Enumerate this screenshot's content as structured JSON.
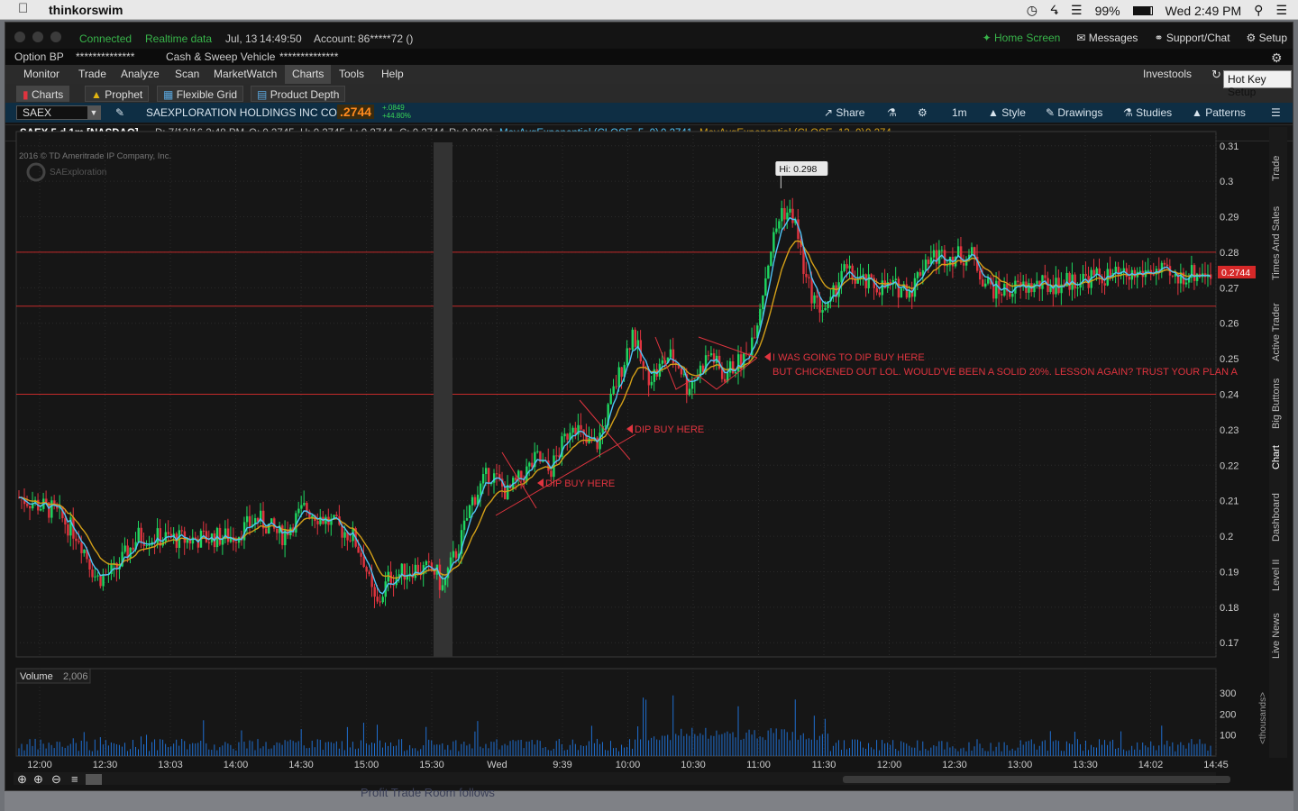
{
  "menubar": {
    "app_name": "thinkorswim",
    "battery": "99%",
    "clock": "Wed 2:49 PM"
  },
  "status": {
    "connected": "Connected",
    "realtime": "Realtime data",
    "date": "Jul, 13",
    "time": "14:49:50",
    "account_label": "Account:",
    "account_value": "86*****72 ()"
  },
  "top_right": {
    "home": "Home Screen",
    "messages": "Messages",
    "support": "Support/Chat",
    "setup": "Setup"
  },
  "bp_row": {
    "option_bp": "Option BP",
    "bp_value": "**************",
    "cash": "Cash & Sweep Vehicle",
    "cash_value": "**************"
  },
  "menu": {
    "items": [
      "Monitor",
      "Trade",
      "Analyze",
      "Scan",
      "MarketWatch",
      "Charts",
      "Tools",
      "Help"
    ],
    "investools": "Investools"
  },
  "subtabs": {
    "charts": "Charts",
    "prophet": "Prophet",
    "flexible": "Flexible Grid",
    "product_depth": "Product Depth"
  },
  "hotkey": "Hot Key Setup",
  "symbol_bar": {
    "symbol": "SAEX",
    "company": "SAEXPLORATION HOLDINGS INC COM",
    "price": ".2744",
    "change": "+.0849",
    "change_pct": "+44.80%",
    "share": "Share",
    "timeframe": "1m",
    "style": "Style",
    "drawings": "Drawings",
    "studies": "Studies",
    "patterns": "Patterns"
  },
  "info_row": {
    "title": "SAEX 5 d 1m [NASDAQ]",
    "d": "D: 7/13/16 2:48 PM",
    "o": "O: 0.2745",
    "h": "H: 0.2745",
    "l": "L: 0.2744",
    "c": "C: 0.2744",
    "r": "R: 0.0001",
    "ma5": "MovAvgExponential (CLOSE, 5, 0)",
    "ma5_val": "0.2741",
    "ma13": "MovAvgExponential (CLOSE, 13, 0)",
    "ma13_val": "0.274"
  },
  "watermark": {
    "copyright": "2016 © TD Ameritrade IP Company, Inc.",
    "logo_text": "SAExploration"
  },
  "annotations": {
    "hi": "Hi: 0.298",
    "dip1": "DIP BUY HERE",
    "dip2": "DIP BUY HERE",
    "note1": "I WAS GOING TO DIP BUY HERE",
    "note2": "BUT CHICKENED OUT LOL. WOULD'VE BEEN A SOLID 20%. LESSON AGAIN? TRUST YOUR PLAN A",
    "last_price": "0.2744"
  },
  "volume_label": "Volume",
  "volume_value": "2,006",
  "volume_unit": "<thousands>",
  "side_tabs": [
    "Trade",
    "Times And Sales",
    "Active Trader",
    "Big Buttons",
    "Chart",
    "Dashboard",
    "Level II",
    "Live News"
  ],
  "bottom_peek": "Profit Trade Room follows",
  "colors": {
    "up": "#1ed760",
    "down": "#e0343f",
    "ma5": "#4fc3f7",
    "ma13": "#d4a018",
    "hline": "#c42a2a",
    "bg": "#161616"
  },
  "chart_data": {
    "type": "candlestick",
    "title": "SAEX 5 d 1m [NASDAQ]",
    "y_ticks": [
      0.17,
      0.18,
      0.19,
      0.2,
      0.21,
      0.22,
      0.23,
      0.24,
      0.25,
      0.26,
      0.27,
      0.28,
      0.29,
      0.3,
      0.31
    ],
    "ylim": [
      0.166,
      0.314
    ],
    "x_ticks": [
      "12:00",
      "12:30",
      "13:03",
      "14:00",
      "14:30",
      "15:00",
      "15:30",
      "Wed",
      "9:39",
      "10:00",
      "10:30",
      "11:00",
      "11:30",
      "12:00",
      "12:30",
      "13:00",
      "13:30",
      "14:02",
      "14:45"
    ],
    "horizontal_lines": [
      0.28,
      0.2648,
      0.24
    ],
    "hi": 0.298,
    "last": 0.2744,
    "price_path": [
      [
        0,
        0.211
      ],
      [
        0.03,
        0.207
      ],
      [
        0.05,
        0.2
      ],
      [
        0.065,
        0.188
      ],
      [
        0.08,
        0.19
      ],
      [
        0.1,
        0.2
      ],
      [
        0.14,
        0.199
      ],
      [
        0.18,
        0.2
      ],
      [
        0.2,
        0.205
      ],
      [
        0.22,
        0.2
      ],
      [
        0.24,
        0.208
      ],
      [
        0.26,
        0.204
      ],
      [
        0.28,
        0.2
      ],
      [
        0.29,
        0.193
      ],
      [
        0.295,
        0.185
      ],
      [
        0.3,
        0.18
      ],
      [
        0.31,
        0.188
      ],
      [
        0.33,
        0.191
      ],
      [
        0.35,
        0.19
      ],
      [
        0.355,
        0.185
      ],
      [
        0.36,
        0.19
      ],
      [
        0.37,
        0.198
      ],
      [
        0.38,
        0.21
      ],
      [
        0.395,
        0.218
      ],
      [
        0.41,
        0.212
      ],
      [
        0.42,
        0.216
      ],
      [
        0.435,
        0.222
      ],
      [
        0.445,
        0.218
      ],
      [
        0.455,
        0.225
      ],
      [
        0.465,
        0.233
      ],
      [
        0.475,
        0.226
      ],
      [
        0.485,
        0.226
      ],
      [
        0.495,
        0.236
      ],
      [
        0.5,
        0.242
      ],
      [
        0.51,
        0.252
      ],
      [
        0.515,
        0.258
      ],
      [
        0.525,
        0.245
      ],
      [
        0.535,
        0.246
      ],
      [
        0.545,
        0.251
      ],
      [
        0.555,
        0.248
      ],
      [
        0.56,
        0.242
      ],
      [
        0.57,
        0.246
      ],
      [
        0.58,
        0.252
      ],
      [
        0.59,
        0.245
      ],
      [
        0.6,
        0.248
      ],
      [
        0.61,
        0.25
      ],
      [
        0.62,
        0.262
      ],
      [
        0.63,
        0.28
      ],
      [
        0.64,
        0.292
      ],
      [
        0.65,
        0.29
      ],
      [
        0.655,
        0.282
      ],
      [
        0.66,
        0.272
      ],
      [
        0.67,
        0.265
      ],
      [
        0.68,
        0.264
      ],
      [
        0.69,
        0.275
      ],
      [
        0.71,
        0.271
      ],
      [
        0.73,
        0.27
      ],
      [
        0.75,
        0.27
      ],
      [
        0.76,
        0.278
      ],
      [
        0.77,
        0.279
      ],
      [
        0.78,
        0.279
      ],
      [
        0.8,
        0.279
      ],
      [
        0.81,
        0.272
      ],
      [
        0.82,
        0.269
      ],
      [
        0.84,
        0.27
      ],
      [
        0.87,
        0.271
      ],
      [
        0.9,
        0.273
      ],
      [
        0.93,
        0.273
      ],
      [
        0.95,
        0.275
      ],
      [
        0.96,
        0.274
      ],
      [
        0.97,
        0.272
      ],
      [
        0.98,
        0.274
      ],
      [
        1,
        0.2744
      ]
    ],
    "volume_ticks": [
      100,
      200,
      300
    ]
  }
}
